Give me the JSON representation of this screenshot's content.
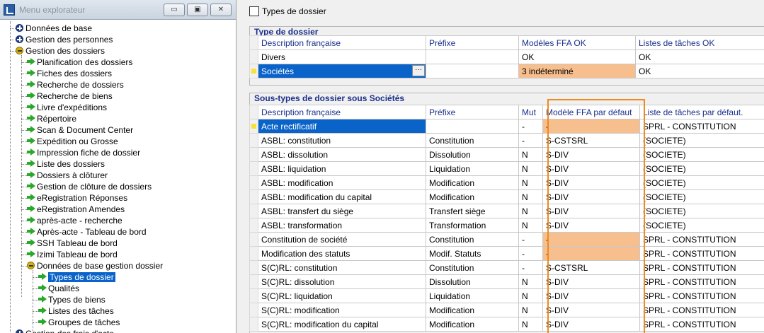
{
  "explorer": {
    "title": "Menu explorateur",
    "window_buttons": {
      "minimize": "▭",
      "restore": "▣",
      "close": "✕"
    },
    "tree": [
      {
        "label": "Données de base",
        "level": 0,
        "icon": "plus-icon"
      },
      {
        "label": "Gestion des personnes",
        "level": 0,
        "icon": "plus-icon"
      },
      {
        "label": "Gestion des dossiers",
        "level": 0,
        "icon": "minus-icon"
      },
      {
        "label": "Planification des dossiers",
        "level": 1,
        "icon": "arrow-icon"
      },
      {
        "label": "Fiches des dossiers",
        "level": 1,
        "icon": "arrow-icon"
      },
      {
        "label": "Recherche de dossiers",
        "level": 1,
        "icon": "arrow-icon"
      },
      {
        "label": "Recherche de biens",
        "level": 1,
        "icon": "arrow-icon"
      },
      {
        "label": "Livre d'expéditions",
        "level": 1,
        "icon": "arrow-icon"
      },
      {
        "label": "Répertoire",
        "level": 1,
        "icon": "arrow-icon"
      },
      {
        "label": "Scan & Document Center",
        "level": 1,
        "icon": "arrow-icon"
      },
      {
        "label": "Expédition ou Grosse",
        "level": 1,
        "icon": "arrow-icon"
      },
      {
        "label": "Impression fiche de dossier",
        "level": 1,
        "icon": "arrow-icon"
      },
      {
        "label": "Liste des dossiers",
        "level": 1,
        "icon": "arrow-icon"
      },
      {
        "label": "Dossiers à clôturer",
        "level": 1,
        "icon": "arrow-icon"
      },
      {
        "label": "Gestion de clôture de dossiers",
        "level": 1,
        "icon": "arrow-icon"
      },
      {
        "label": "eRegistration Réponses",
        "level": 1,
        "icon": "arrow-icon"
      },
      {
        "label": "eRegistration Amendes",
        "level": 1,
        "icon": "arrow-icon"
      },
      {
        "label": "après-acte - recherche",
        "level": 1,
        "icon": "arrow-icon"
      },
      {
        "label": "Après-acte - Tableau de bord",
        "level": 1,
        "icon": "arrow-icon"
      },
      {
        "label": "SSH Tableau de bord",
        "level": 1,
        "icon": "arrow-icon"
      },
      {
        "label": "Izimi Tableau de bord",
        "level": 1,
        "icon": "arrow-icon"
      },
      {
        "label": "Données de base gestion dossier",
        "level": 1,
        "icon": "minus-icon"
      },
      {
        "label": "Types de dossier",
        "level": 2,
        "icon": "arrow-icon",
        "selected": true
      },
      {
        "label": "Qualités",
        "level": 2,
        "icon": "arrow-icon"
      },
      {
        "label": "Types de biens",
        "level": 2,
        "icon": "arrow-icon"
      },
      {
        "label": "Listes des tâches",
        "level": 2,
        "icon": "arrow-icon"
      },
      {
        "label": "Groupes de tâches",
        "level": 2,
        "icon": "arrow-icon"
      },
      {
        "label": "Gestion des frais d'acte",
        "level": 0,
        "icon": "plus-icon"
      }
    ]
  },
  "document": {
    "tab_label": "Types de dossier"
  },
  "types_group": {
    "title": "Type de dossier",
    "columns": [
      "Description française",
      "Préfixe",
      "Modèles FFA OK",
      "Listes de tâches OK"
    ],
    "rows": [
      {
        "desc": "Divers",
        "prefix": "",
        "ffa": "OK",
        "tasks": "OK"
      },
      {
        "desc": "Sociétés",
        "prefix": "",
        "ffa": "3 indéterminé",
        "tasks": "OK",
        "current": true,
        "ffa_orange": true
      }
    ],
    "ellipsis": "···"
  },
  "subtypes_group": {
    "title": "Sous-types de dossier sous Sociétés",
    "columns": [
      "Description française",
      "Préfixe",
      "Mut",
      "Modèle FFA par défaut",
      "Liste de tâches par défaut."
    ],
    "rows": [
      {
        "desc": "Acte rectificatif",
        "prefix": "",
        "mut": "-",
        "ffa": "-",
        "tasks": "SPRL - CONSTITUTION",
        "current": true,
        "orange": true
      },
      {
        "desc": "ASBL: constitution",
        "prefix": "Constitution",
        "mut": "-",
        "ffa": "S-CSTSRL",
        "tasks": "(SOCIETE)"
      },
      {
        "desc": "ASBL: dissolution",
        "prefix": "Dissolution",
        "mut": "N",
        "ffa": "S-DIV",
        "tasks": "(SOCIETE)"
      },
      {
        "desc": "ASBL: liquidation",
        "prefix": "Liquidation",
        "mut": "N",
        "ffa": "S-DIV",
        "tasks": "(SOCIETE)"
      },
      {
        "desc": "ASBL: modification",
        "prefix": "Modification",
        "mut": "N",
        "ffa": "S-DIV",
        "tasks": "(SOCIETE)"
      },
      {
        "desc": "ASBL: modification du capital",
        "prefix": "Modification",
        "mut": "N",
        "ffa": "S-DIV",
        "tasks": "(SOCIETE)"
      },
      {
        "desc": "ASBL: transfert du siège",
        "prefix": "Transfert siège",
        "mut": "N",
        "ffa": "S-DIV",
        "tasks": "(SOCIETE)"
      },
      {
        "desc": "ASBL: transformation",
        "prefix": "Transformation",
        "mut": "N",
        "ffa": "S-DIV",
        "tasks": "(SOCIETE)"
      },
      {
        "desc": "Constitution de société",
        "prefix": "Constitution",
        "mut": "-",
        "ffa": "-",
        "tasks": "SPRL - CONSTITUTION",
        "orange": true
      },
      {
        "desc": "Modification des statuts",
        "prefix": "Modif. Statuts",
        "mut": "-",
        "ffa": "-",
        "tasks": "SPRL - CONSTITUTION",
        "orange": true
      },
      {
        "desc": "S(C)RL: constitution",
        "prefix": "Constitution",
        "mut": "-",
        "ffa": "S-CSTSRL",
        "tasks": "SPRL - CONSTITUTION"
      },
      {
        "desc": "S(C)RL: dissolution",
        "prefix": "Dissolution",
        "mut": "N",
        "ffa": "S-DIV",
        "tasks": "SPRL - CONSTITUTION"
      },
      {
        "desc": "S(C)RL: liquidation",
        "prefix": "Liquidation",
        "mut": "N",
        "ffa": "S-DIV",
        "tasks": "SPRL - CONSTITUTION"
      },
      {
        "desc": "S(C)RL: modification",
        "prefix": "Modification",
        "mut": "N",
        "ffa": "S-DIV",
        "tasks": "SPRL - CONSTITUTION"
      },
      {
        "desc": "S(C)RL: modification du capital",
        "prefix": "Modification",
        "mut": "N",
        "ffa": "S-DIV",
        "tasks": "SPRL - CONSTITUTION"
      }
    ]
  },
  "colors": {
    "selection": "#0a63c9",
    "header_text": "#1a2f8a",
    "orange_cell": "#f7bf8e",
    "highlight_box": "#f08a1e"
  }
}
